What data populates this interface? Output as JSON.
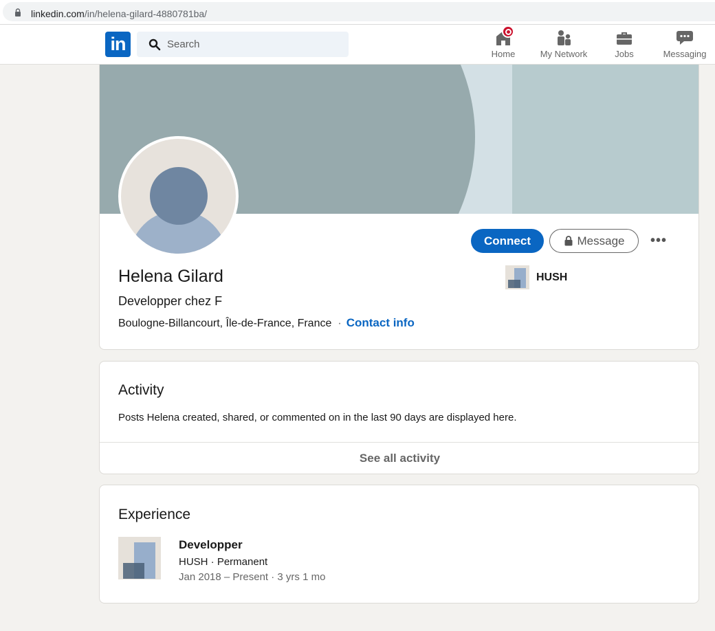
{
  "browser": {
    "url_host": "linkedin.com",
    "url_path": "/in/helena-gilard-4880781ba/"
  },
  "nav": {
    "logo_text": "in",
    "search_placeholder": "Search",
    "items": [
      {
        "label": "Home",
        "icon": "home-icon",
        "has_badge": true
      },
      {
        "label": "My Network",
        "icon": "network-icon"
      },
      {
        "label": "Jobs",
        "icon": "briefcase-icon"
      },
      {
        "label": "Messaging",
        "icon": "chat-icon"
      }
    ]
  },
  "profile": {
    "name": "Helena Gilard",
    "headline": "Developper chez F",
    "location": "Boulogne-Billancourt, Île-de-France, France",
    "separator": "·",
    "contact_info": "Contact info",
    "connect_label": "Connect",
    "message_label": "Message",
    "more_label": "•••",
    "current_company": "HUSH"
  },
  "activity": {
    "title": "Activity",
    "text": "Posts Helena created, shared, or commented on in the last 90 days are displayed here.",
    "see_all": "See all activity"
  },
  "experience": {
    "title": "Experience",
    "items": [
      {
        "role": "Developper",
        "company_line": "HUSH · Permanent",
        "dates": "Jan 2018 – Present · 3 yrs 1 mo"
      }
    ]
  },
  "colors": {
    "brand": "#0a66c2",
    "badge": "#cb112d",
    "background": "#f3f2ef"
  }
}
